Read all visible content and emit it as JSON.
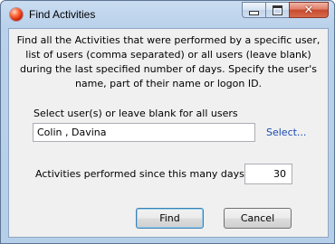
{
  "window": {
    "title": "Find Activities",
    "app_icon": "red-ball-icon",
    "caption_buttons": {
      "minimize": "minimize-icon",
      "maximize": "maximize-icon",
      "close": "close-icon"
    }
  },
  "description": "Find all the Activities that were performed by a specific user, list of users (comma separated) or all users (leave blank) during the last specified number of days. Specify the user's name, part of their name or logon ID.",
  "users": {
    "label": "Select user(s) or leave blank for all users",
    "value": "Colin , Davina",
    "select_link": "Select..."
  },
  "days": {
    "label": "Activities performed since this many days ago",
    "value": "30"
  },
  "buttons": {
    "find": "Find",
    "cancel": "Cancel"
  },
  "colors": {
    "link": "#1a4ab0",
    "frame": "#b9d1ea",
    "close_button": "#c84a2e"
  }
}
